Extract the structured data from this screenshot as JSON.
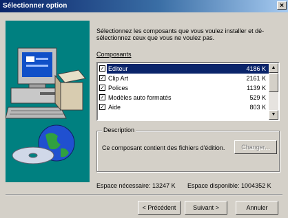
{
  "window": {
    "title": "Sélectionner option",
    "close_label": "×"
  },
  "instructions": "Sélectionnez les composants que vous voulez installer et dé-sélectionnez ceux que vous ne voulez pas.",
  "components": {
    "label": "Composants",
    "items": [
      {
        "name": "Editeur",
        "size": "4186 K",
        "checked": true,
        "selected": true
      },
      {
        "name": "Clip Art",
        "size": "2161 K",
        "checked": true,
        "selected": false
      },
      {
        "name": "Polices",
        "size": "1139 K",
        "checked": true,
        "selected": false
      },
      {
        "name": "Modèles auto formatés",
        "size": "529 K",
        "checked": true,
        "selected": false
      },
      {
        "name": "Aide",
        "size": "803 K",
        "checked": true,
        "selected": false
      }
    ],
    "check_mark": "✓"
  },
  "description": {
    "title": "Description",
    "text": "Ce composant contient des fichiers d'édition.",
    "change_button": "Changer..."
  },
  "space": {
    "required": "Espace nécessaire:  13247 K",
    "available": "Espace disponible:  1004352 K"
  },
  "buttons": {
    "back": "< Précédent",
    "next": "Suivant >",
    "cancel": "Annuler"
  },
  "colors": {
    "title_bar": "#0a246a",
    "artwork_bg": "#008080",
    "face": "#d4d0c8"
  }
}
